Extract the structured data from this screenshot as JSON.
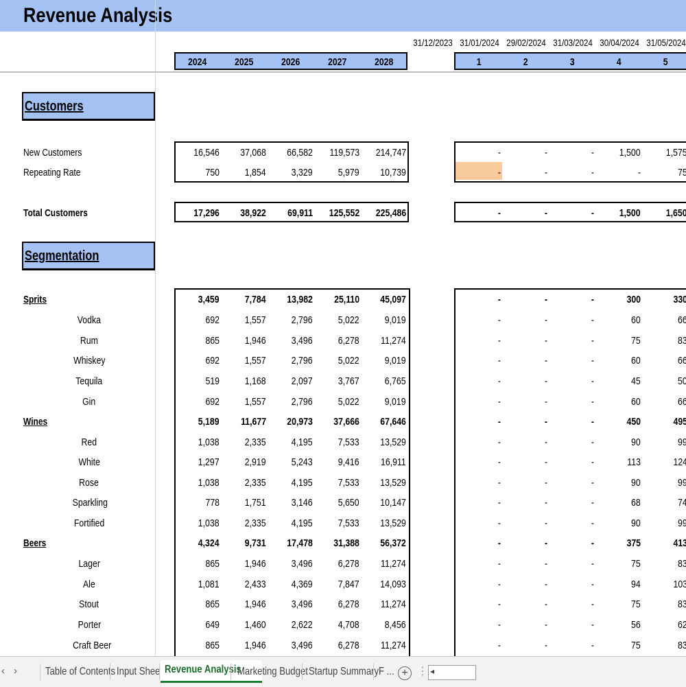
{
  "title": "Revenue Analysis",
  "dates": [
    "31/12/2023",
    "31/01/2024",
    "29/02/2024",
    "31/03/2024",
    "30/04/2024",
    "31/05/2024"
  ],
  "years": [
    "2024",
    "2025",
    "2026",
    "2027",
    "2028"
  ],
  "months": [
    "1",
    "2",
    "3",
    "4",
    "5"
  ],
  "sections": {
    "customers": "Customers",
    "segmentation": "Segmentation"
  },
  "customers": {
    "new": {
      "label": "New Customers",
      "years": [
        "16,546",
        "37,068",
        "66,582",
        "119,573",
        "214,747"
      ],
      "months": [
        "-",
        "-",
        "-",
        "1,500",
        "1,575"
      ]
    },
    "repeat": {
      "label": "Repeating Rate",
      "years": [
        "750",
        "1,854",
        "3,329",
        "5,979",
        "10,739"
      ],
      "months": [
        "-",
        "-",
        "-",
        "-",
        "75"
      ]
    },
    "total": {
      "label": "Total Customers",
      "years": [
        "17,296",
        "38,922",
        "69,911",
        "125,552",
        "225,486"
      ],
      "months": [
        "-",
        "-",
        "-",
        "1,500",
        "1,650"
      ]
    }
  },
  "segments": [
    {
      "label": "Sprits",
      "group": true,
      "years": [
        "3,459",
        "7,784",
        "13,982",
        "25,110",
        "45,097"
      ],
      "months": [
        "-",
        "-",
        "-",
        "300",
        "330"
      ]
    },
    {
      "label": "Vodka",
      "years": [
        "692",
        "1,557",
        "2,796",
        "5,022",
        "9,019"
      ],
      "months": [
        "-",
        "-",
        "-",
        "60",
        "66"
      ]
    },
    {
      "label": "Rum",
      "years": [
        "865",
        "1,946",
        "3,496",
        "6,278",
        "11,274"
      ],
      "months": [
        "-",
        "-",
        "-",
        "75",
        "83"
      ]
    },
    {
      "label": "Whiskey",
      "years": [
        "692",
        "1,557",
        "2,796",
        "5,022",
        "9,019"
      ],
      "months": [
        "-",
        "-",
        "-",
        "60",
        "66"
      ]
    },
    {
      "label": "Tequila",
      "years": [
        "519",
        "1,168",
        "2,097",
        "3,767",
        "6,765"
      ],
      "months": [
        "-",
        "-",
        "-",
        "45",
        "50"
      ]
    },
    {
      "label": "Gin",
      "years": [
        "692",
        "1,557",
        "2,796",
        "5,022",
        "9,019"
      ],
      "months": [
        "-",
        "-",
        "-",
        "60",
        "66"
      ]
    },
    {
      "label": "Wines",
      "group": true,
      "years": [
        "5,189",
        "11,677",
        "20,973",
        "37,666",
        "67,646"
      ],
      "months": [
        "-",
        "-",
        "-",
        "450",
        "495"
      ]
    },
    {
      "label": "Red",
      "years": [
        "1,038",
        "2,335",
        "4,195",
        "7,533",
        "13,529"
      ],
      "months": [
        "-",
        "-",
        "-",
        "90",
        "99"
      ]
    },
    {
      "label": "White",
      "years": [
        "1,297",
        "2,919",
        "5,243",
        "9,416",
        "16,911"
      ],
      "months": [
        "-",
        "-",
        "-",
        "113",
        "124"
      ]
    },
    {
      "label": "Rose",
      "years": [
        "1,038",
        "2,335",
        "4,195",
        "7,533",
        "13,529"
      ],
      "months": [
        "-",
        "-",
        "-",
        "90",
        "99"
      ]
    },
    {
      "label": "Sparkling",
      "years": [
        "778",
        "1,751",
        "3,146",
        "5,650",
        "10,147"
      ],
      "months": [
        "-",
        "-",
        "-",
        "68",
        "74"
      ]
    },
    {
      "label": "Fortified",
      "years": [
        "1,038",
        "2,335",
        "4,195",
        "7,533",
        "13,529"
      ],
      "months": [
        "-",
        "-",
        "-",
        "90",
        "99"
      ]
    },
    {
      "label": "Beers",
      "group": true,
      "years": [
        "4,324",
        "9,731",
        "17,478",
        "31,388",
        "56,372"
      ],
      "months": [
        "-",
        "-",
        "-",
        "375",
        "413"
      ]
    },
    {
      "label": "Lager",
      "years": [
        "865",
        "1,946",
        "3,496",
        "6,278",
        "11,274"
      ],
      "months": [
        "-",
        "-",
        "-",
        "75",
        "83"
      ]
    },
    {
      "label": "Ale",
      "years": [
        "1,081",
        "2,433",
        "4,369",
        "7,847",
        "14,093"
      ],
      "months": [
        "-",
        "-",
        "-",
        "94",
        "103"
      ]
    },
    {
      "label": "Stout",
      "years": [
        "865",
        "1,946",
        "3,496",
        "6,278",
        "11,274"
      ],
      "months": [
        "-",
        "-",
        "-",
        "75",
        "83"
      ]
    },
    {
      "label": "Porter",
      "years": [
        "649",
        "1,460",
        "2,622",
        "4,708",
        "8,456"
      ],
      "months": [
        "-",
        "-",
        "-",
        "56",
        "62"
      ]
    },
    {
      "label": "Craft Beer",
      "years": [
        "865",
        "1,946",
        "3,496",
        "6,278",
        "11,274"
      ],
      "months": [
        "-",
        "-",
        "-",
        "75",
        "83"
      ]
    }
  ],
  "tabs": [
    "Table of Contents",
    "Input Sheet",
    "Revenue Analysis",
    "Marketing Budget",
    "Startup Summary",
    "F ..."
  ],
  "active_tab": "Revenue Analysis",
  "highlight_color": "#f9cb9c",
  "header_color": "#a4c2f4",
  "active_tab_color": "#1e7b34"
}
